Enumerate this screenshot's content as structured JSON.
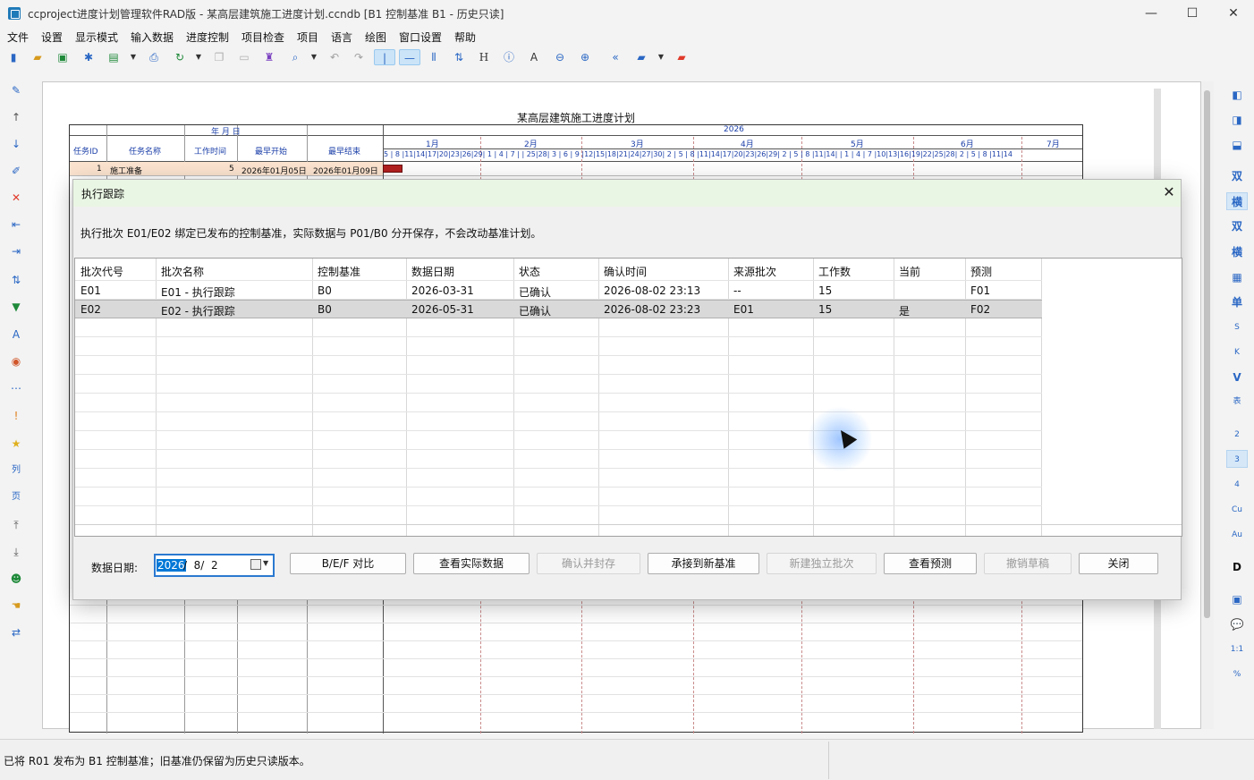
{
  "window": {
    "title": "ccproject进度计划管理软件RAD版 - 某高层建筑施工进度计划.ccndb [B1 控制基准 B1 - 历史只读]",
    "minimize": "—",
    "maximize": "☐",
    "close": "✕"
  },
  "menu": [
    "文件",
    "设置",
    "显示模式",
    "输入数据",
    "进度控制",
    "项目检查",
    "项目",
    "语言",
    "绘图",
    "窗口设置",
    "帮助"
  ],
  "toolbar_icons": [
    "new-icon",
    "open-icon",
    "save-icon",
    "asterisk-icon",
    "export-icon",
    "dropdown-icon",
    "print-icon",
    "refresh-icon",
    "dropdown-icon",
    "copy-icon",
    "paste-icon",
    "format-brush-icon",
    "search-icon",
    "dropdown-icon",
    "undo-icon",
    "redo-icon",
    "vertical-line-icon",
    "horizontal-line-icon",
    "columns-icon",
    "sort-icon",
    "h-icon",
    "info-icon",
    "text-icon",
    "zoom-out-icon",
    "zoom-in-icon",
    "back-icon",
    "folder-icon",
    "dropdown-icon",
    "folder-red-icon"
  ],
  "left_icons": [
    "pencil-icon",
    "arrow-up-icon",
    "arrow-down-icon",
    "edit-icon",
    "delete-icon",
    "outdent-icon",
    "indent-icon",
    "sort-icon",
    "filter-icon",
    "font-icon",
    "palette-icon",
    "dots-icon",
    "warning-icon",
    "star-icon",
    "column-icon",
    "page-icon",
    "top-icon",
    "bottom-icon",
    "users-icon",
    "hand-icon",
    "swap-icon"
  ],
  "right_labels": [
    "双",
    "横",
    "双",
    "横",
    "单",
    "S",
    "K",
    "V",
    "表",
    "2",
    "3",
    "4",
    "Cu",
    "Au",
    "D",
    "%"
  ],
  "gantt": {
    "title": "某高层建筑施工进度计划",
    "header_date": "年 月 日",
    "year": "2026",
    "columns": [
      "任务ID",
      "任务名称",
      "工作时间",
      "最早开始",
      "最早结束"
    ],
    "months": [
      "1月",
      "2月",
      "3月",
      "4月",
      "5月",
      "6月",
      "7月"
    ],
    "days": "5 | 8 |11|14|17|20|23|26|29| 1 | 4 | 7 |                | 25|28| 3 | 6 | 9 |12|15|18|21|24|27|30| 2 | 5 | 8 |11|14|17|20|23|26|29| 2 | 5 | 8 |11|14|                | 1 | 4 | 7 |10|13|16|19|22|25|28| 2 | 5 | 8 |11|14",
    "row1": {
      "id": "1",
      "name": "施工准备",
      "duration": "5",
      "start": "2026年01月05日",
      "end": "2026年01月09日"
    }
  },
  "dialog": {
    "title": "执行跟踪",
    "close": "✕",
    "description": "执行批次 E01/E02 绑定已发布的控制基准，实际数据与 P01/B0 分开保存，不会改动基准计划。",
    "headers": [
      "批次代号",
      "批次名称",
      "控制基准",
      "数据日期",
      "状态",
      "确认时间",
      "来源批次",
      "工作数",
      "当前",
      "预测"
    ],
    "rows": [
      [
        "E01",
        "E01 - 执行跟踪",
        "B0",
        "2026-03-31",
        "已确认",
        "2026-08-02 23:13",
        "--",
        "15",
        "",
        "F01"
      ],
      [
        "E02",
        "E02 - 执行跟踪",
        "B0",
        "2026-05-31",
        "已确认",
        "2026-08-02 23:23",
        "E01",
        "15",
        "是",
        "F02"
      ]
    ],
    "data_date_label": "数据日期:",
    "data_date_selected": "2026",
    "data_date_rest": "/  8/  2",
    "buttons": [
      {
        "label": "B/E/F 对比",
        "enabled": true
      },
      {
        "label": "查看实际数据",
        "enabled": true
      },
      {
        "label": "确认并封存",
        "enabled": false
      },
      {
        "label": "承接到新基准",
        "enabled": true
      },
      {
        "label": "新建独立批次",
        "enabled": false
      },
      {
        "label": "查看预测",
        "enabled": true
      },
      {
        "label": "撤销草稿",
        "enabled": false
      },
      {
        "label": "关闭",
        "enabled": true
      }
    ]
  },
  "status": {
    "text": "已将 R01 发布为 B1 控制基准；旧基准仍保留为历史只读版本。"
  }
}
